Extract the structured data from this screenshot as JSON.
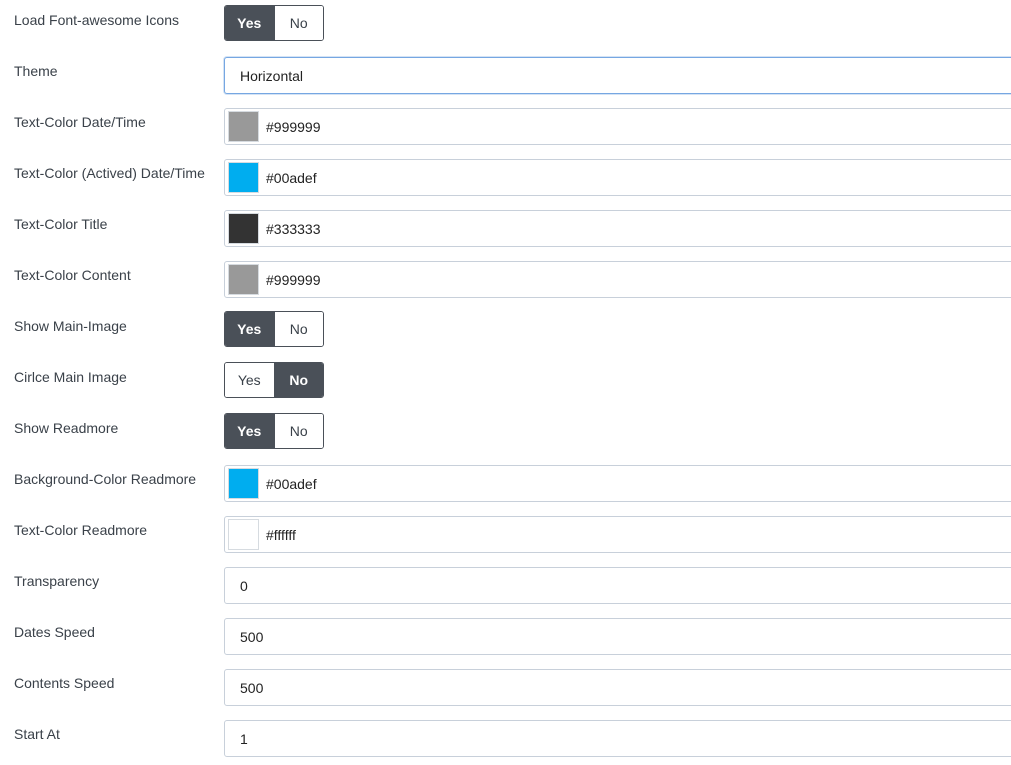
{
  "rows": {
    "load_fa": {
      "label": "Load Font-awesome Icons",
      "yes": "Yes",
      "no": "No",
      "selected": "Yes"
    },
    "theme": {
      "label": "Theme",
      "value": "Horizontal"
    },
    "tc_date": {
      "label": "Text-Color Date/Time",
      "value": "#999999",
      "color": "#999999"
    },
    "tc_date_active": {
      "label": "Text-Color (Actived) Date/Time",
      "value": "#00adef",
      "color": "#00adef"
    },
    "tc_title": {
      "label": "Text-Color Title",
      "value": "#333333",
      "color": "#333333"
    },
    "tc_content": {
      "label": "Text-Color Content",
      "value": "#999999",
      "color": "#999999"
    },
    "show_main_image": {
      "label": "Show Main-Image",
      "yes": "Yes",
      "no": "No",
      "selected": "Yes"
    },
    "circle_main_image": {
      "label": "Cirlce Main Image",
      "yes": "Yes",
      "no": "No",
      "selected": "No"
    },
    "show_readmore": {
      "label": "Show Readmore",
      "yes": "Yes",
      "no": "No",
      "selected": "Yes"
    },
    "bg_readmore": {
      "label": "Background-Color Readmore",
      "value": "#00adef",
      "color": "#00adef"
    },
    "tc_readmore": {
      "label": "Text-Color Readmore",
      "value": "#ffffff",
      "color": "#ffffff"
    },
    "transparency": {
      "label": "Transparency",
      "value": "0"
    },
    "dates_speed": {
      "label": "Dates Speed",
      "value": "500"
    },
    "contents_speed": {
      "label": "Contents Speed",
      "value": "500"
    },
    "start_at": {
      "label": "Start At",
      "value": "1"
    }
  }
}
